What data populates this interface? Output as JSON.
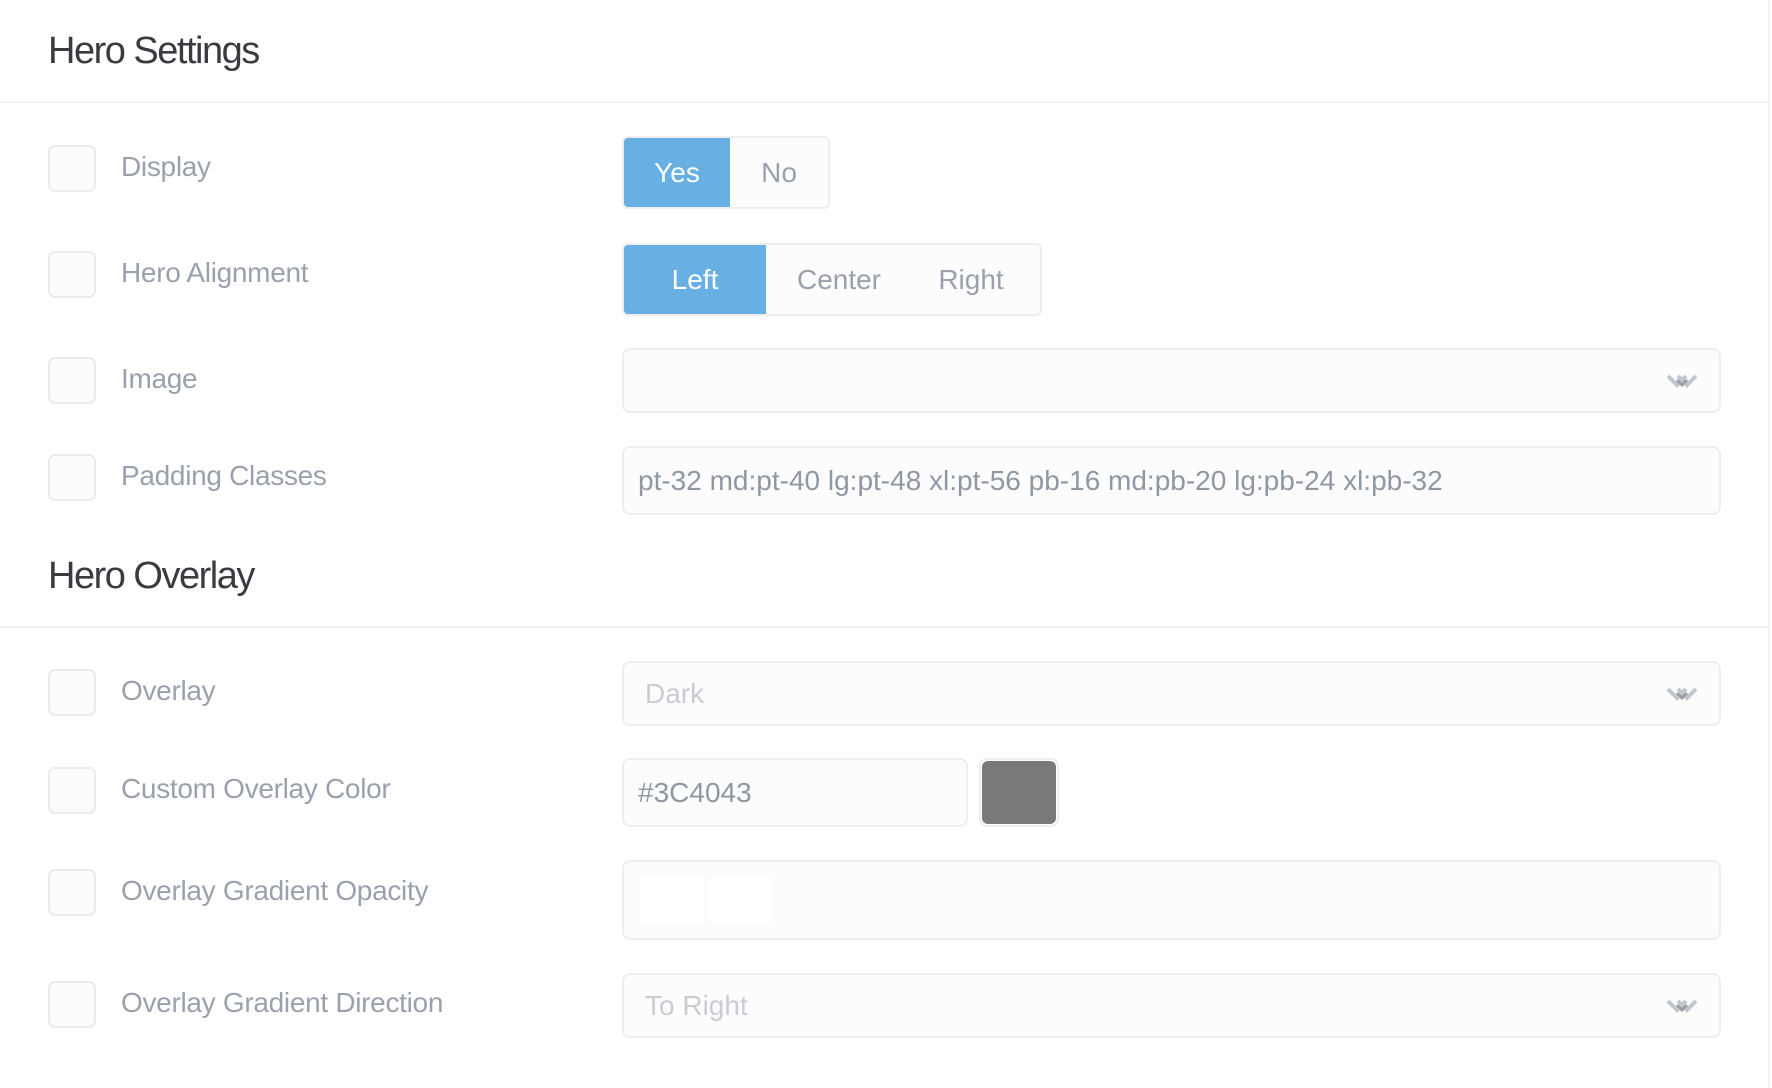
{
  "sections": {
    "hero_settings": {
      "title": "Hero Settings"
    },
    "hero_overlay": {
      "title": "Hero Overlay"
    }
  },
  "rows": {
    "display": {
      "label": "Display",
      "options": [
        "Yes",
        "No"
      ],
      "selected": "Yes"
    },
    "hero_alignment": {
      "label": "Hero Alignment",
      "options": [
        "Left",
        "Center",
        "Right"
      ],
      "selected": "Left"
    },
    "image": {
      "label": "Image",
      "value": "",
      "icon": "chevron-down-icon"
    },
    "padding_classes": {
      "label": "Padding Classes",
      "value": "pt-32 md:pt-40 lg:pt-48 xl:pt-56 pb-16 md:pb-20 lg:pb-24 xl:pb-32"
    },
    "overlay": {
      "label": "Overlay",
      "value": "Dark",
      "icon": "chevron-down-icon"
    },
    "custom_overlay_color": {
      "label": "Custom Overlay Color",
      "value": "#3C4043",
      "swatch_color": "#77797b"
    },
    "overlay_gradient_opacity": {
      "label": "Overlay Gradient Opacity",
      "value": ""
    },
    "overlay_gradient_direction": {
      "label": "Overlay Gradient Direction",
      "value": "To Right",
      "icon": "chevron-down-icon"
    }
  },
  "colors": {
    "accent": "#68b0e4",
    "label": "#9aa1ad",
    "heading": "#3a3b40",
    "border": "#eeeeee"
  }
}
